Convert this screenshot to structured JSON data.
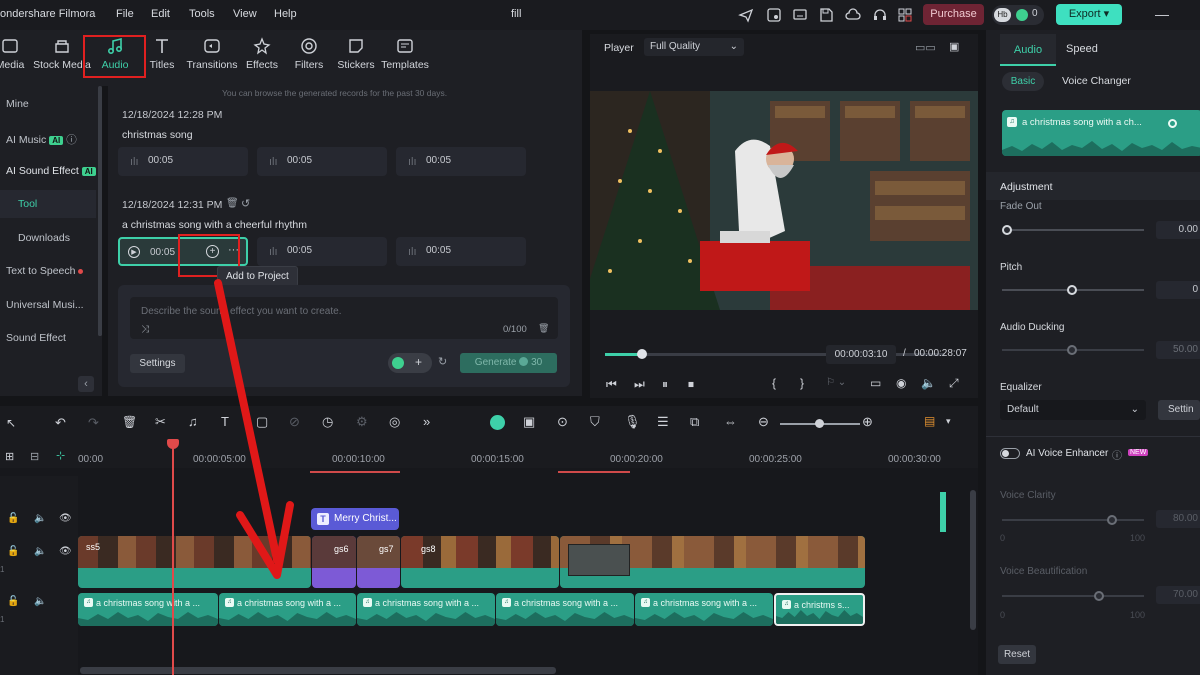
{
  "menubar": {
    "app_name": "ondershare Filmora",
    "menus": [
      "File",
      "Edit",
      "Tools",
      "View",
      "Help"
    ],
    "project_name": "fill",
    "purchase_label": "Purchase",
    "avatar_initials": "Hb",
    "credits": "0",
    "export_label": "Export"
  },
  "tabs": [
    {
      "label": "Media",
      "icon": "media-icon"
    },
    {
      "label": "Stock Media",
      "icon": "stock-media-icon"
    },
    {
      "label": "Audio",
      "icon": "music-note-icon"
    },
    {
      "label": "Titles",
      "icon": "titles-icon"
    },
    {
      "label": "Transitions",
      "icon": "transitions-icon"
    },
    {
      "label": "Effects",
      "icon": "effects-icon"
    },
    {
      "label": "Filters",
      "icon": "filters-icon"
    },
    {
      "label": "Stickers",
      "icon": "stickers-icon"
    },
    {
      "label": "Templates",
      "icon": "templates-icon"
    }
  ],
  "leftnav": {
    "items": [
      "Mine",
      "AI Music",
      "AI Sound Effect",
      "Tool",
      "Downloads",
      "Text to Speech",
      "Universal Musi...",
      "Sound Effect"
    ],
    "ai_badge": "AI"
  },
  "library": {
    "notice": "You can browse the generated records for the past 30 days.",
    "groups": [
      {
        "timestamp": "12/18/2024 12:28 PM",
        "prompt": "christmas song",
        "clips": [
          "00:05",
          "00:05",
          "00:05"
        ]
      },
      {
        "timestamp": "12/18/2024 12:31 PM",
        "prompt": "a christmas song with a cheerful rhythm",
        "clips": [
          "00:05",
          "00:05",
          "00:05"
        ]
      }
    ],
    "tooltip": "Add to Project",
    "prompt_placeholder": "Describe the sound effect you want to create.",
    "char_count": "0/100",
    "settings_label": "Settings",
    "generate_label": "Generate",
    "generate_credits": "30"
  },
  "player": {
    "label": "Player",
    "quality": "Full Quality",
    "current_time": "00:00:03:10",
    "separator": "/",
    "total_time": "00:00:28:07",
    "progress": 0.11
  },
  "rightpanel": {
    "tabs": [
      "Audio",
      "Speed"
    ],
    "subtabs": [
      "Basic",
      "Voice Changer"
    ],
    "clip_name": "a christmas song with a ch...",
    "adjustment_title": "Adjustment",
    "fade_out_label": "Fade Out",
    "fade_out_value": "0.00",
    "pitch_label": "Pitch",
    "pitch_value": "0",
    "ducking_label": "Audio Ducking",
    "ducking_value": "50.00",
    "equalizer_label": "Equalizer",
    "equalizer_value": "Default",
    "equalizer_settings": "Settin",
    "enhancer_label": "AI Voice Enhancer",
    "enhancer_badge": "NEW",
    "clarity_label": "Voice Clarity",
    "clarity_value": "80.00",
    "clarity_min": "0",
    "clarity_max": "100",
    "beautify_label": "Voice Beautification",
    "beautify_value": "70.00",
    "beautify_min": "0",
    "beautify_max": "100",
    "reset_label": "Reset"
  },
  "timeline": {
    "ruler": [
      "00:00",
      "00:00:05:00",
      "00:00:10:00",
      "00:00:15:00",
      "00:00:20:00",
      "00:00:25:00",
      "00:00:30:00"
    ],
    "title_clip": "Merry Christ...",
    "video_labels": [
      "ss5",
      "gs6",
      "gs7",
      "gs8"
    ],
    "audio_clip_label": "a christmas song with a ...",
    "audio_last_label": "a christms s...",
    "track_nums": [
      "1",
      "1"
    ]
  },
  "colors": {
    "accent": "#3ed0a9",
    "highlight": "#e02020",
    "purchase": "#7a2a3a",
    "title_clip": "#5a5ad6"
  }
}
